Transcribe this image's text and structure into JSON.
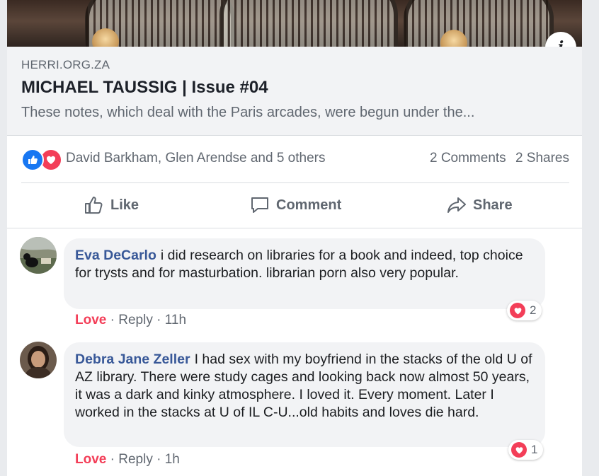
{
  "link_preview": {
    "domain": "HERRI.ORG.ZA",
    "title": "MICHAEL TAUSSIG | Issue #04",
    "description": "These notes, which deal with the Paris arcades, were begun under the...",
    "info_icon": "info-icon"
  },
  "reactions": {
    "icons": [
      "like-icon",
      "love-icon"
    ],
    "names": "David Barkham, Glen Arendse and 5 others",
    "comments_count": "2 Comments",
    "shares_count": "2 Shares"
  },
  "actions": {
    "like": "Like",
    "comment": "Comment",
    "share": "Share"
  },
  "comments": [
    {
      "author": "Eva DeCarlo",
      "text": "i did research on libraries for a book and indeed, top choice for trysts and for masturbation. librarian porn also very popular.",
      "love": "Love",
      "reply": "Reply",
      "time": "11h",
      "reaction_count": "2"
    },
    {
      "author": "Debra Jane Zeller",
      "text": "I had sex with my boyfriend in the stacks of the old U of AZ library. There were study cages and looking back now almost 50 years, it was a dark and kinky atmosphere. I loved it. Every moment. Later I worked in the stacks at U of IL C-U...old habits and loves die hard.",
      "love": "Love",
      "reply": "Reply",
      "time": "1h",
      "reaction_count": "1"
    }
  ],
  "separator": "·",
  "colors": {
    "link_blue": "#385898",
    "love_red": "#f33e58",
    "like_blue": "#1877f2",
    "muted_text": "#606770",
    "bubble_bg": "#f2f3f5"
  }
}
